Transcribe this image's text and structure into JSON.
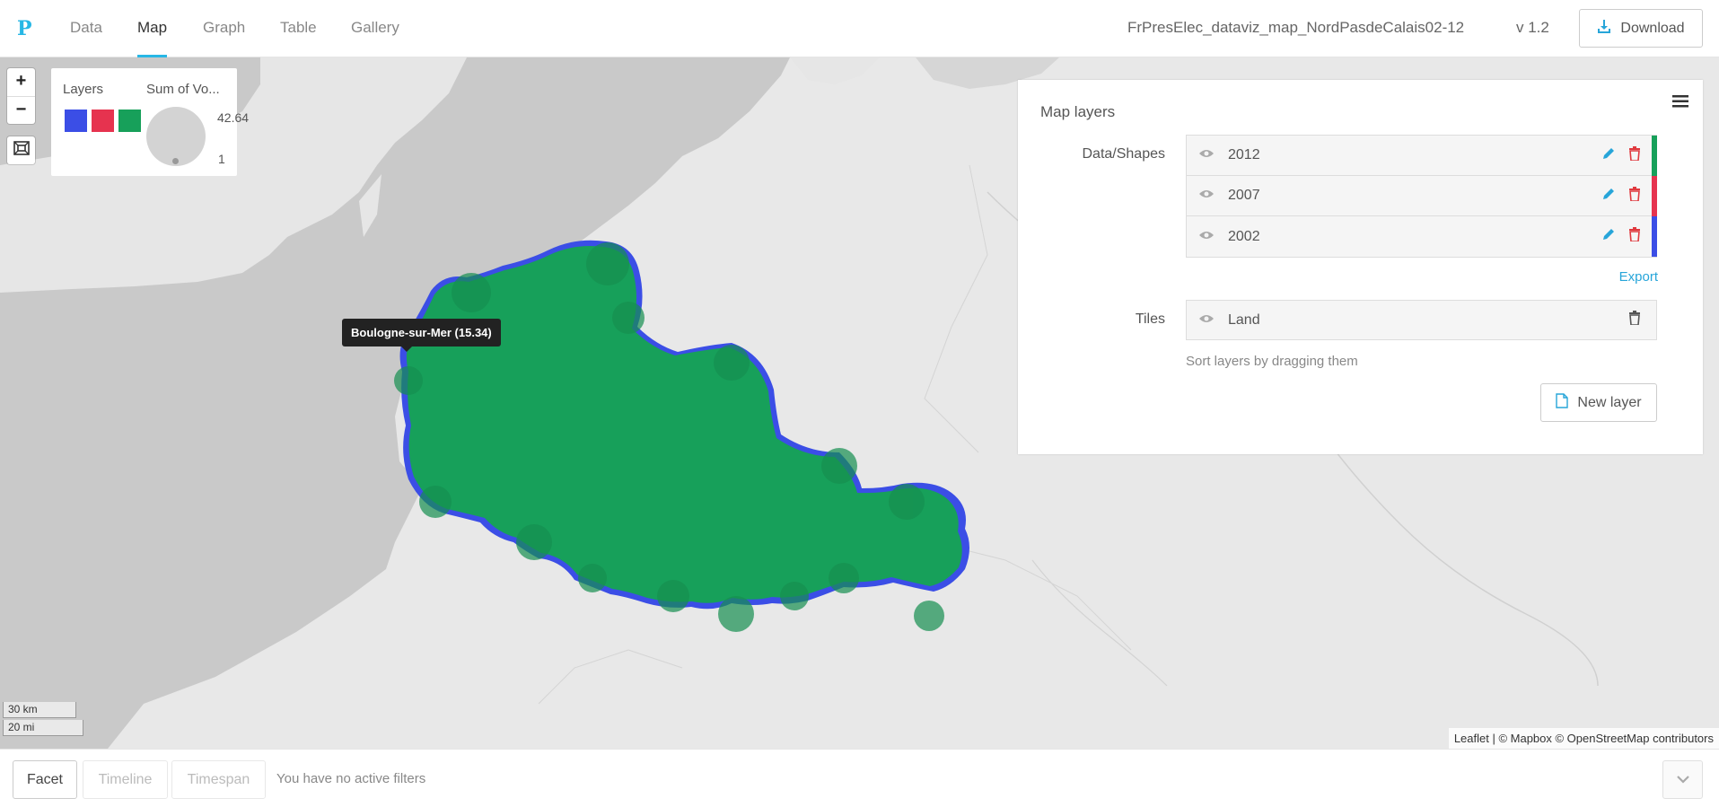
{
  "app": {
    "logo": "P",
    "nav_tabs": [
      {
        "label": "Data",
        "active": false
      },
      {
        "label": "Map",
        "active": true
      },
      {
        "label": "Graph",
        "active": false
      },
      {
        "label": "Table",
        "active": false
      },
      {
        "label": "Gallery",
        "active": false
      }
    ],
    "filename": "FrPresElec_dataviz_map_NordPasdeCalais02-12",
    "version": "v 1.2",
    "download_label": "Download"
  },
  "map": {
    "zoom_in": "+",
    "zoom_out": "−",
    "legend": {
      "layers_label": "Layers",
      "size_label": "Sum of Vo...",
      "max_value": "42.64",
      "min_value": "1",
      "swatch_colors": [
        "#3b4ee6",
        "#e6334f",
        "#17a05a"
      ]
    },
    "tooltip": "Boulogne-sur-Mer (15.34)",
    "scale": {
      "km": "30 km",
      "mi": "20 mi"
    },
    "attribution": "Leaflet | © Mapbox © OpenStreetMap contributors",
    "colors": {
      "land": "#e8e8e8",
      "sea": "#c8c8c8",
      "region_fill": "#17a05a",
      "region_outline": "#3b4ee6"
    }
  },
  "layers_panel": {
    "title": "Map layers",
    "data_shapes_label": "Data/Shapes",
    "layers": [
      {
        "name": "2012",
        "color": "#17a05a"
      },
      {
        "name": "2007",
        "color": "#e6334f"
      },
      {
        "name": "2002",
        "color": "#3b4ee6"
      }
    ],
    "export_label": "Export",
    "tiles_label": "Tiles",
    "tile_layer": {
      "name": "Land"
    },
    "sort_hint": "Sort layers by dragging them",
    "new_layer_label": "New layer"
  },
  "filters": {
    "facet_label": "Facet",
    "timeline_label": "Timeline",
    "timespan_label": "Timespan",
    "message": "You have no active filters"
  }
}
